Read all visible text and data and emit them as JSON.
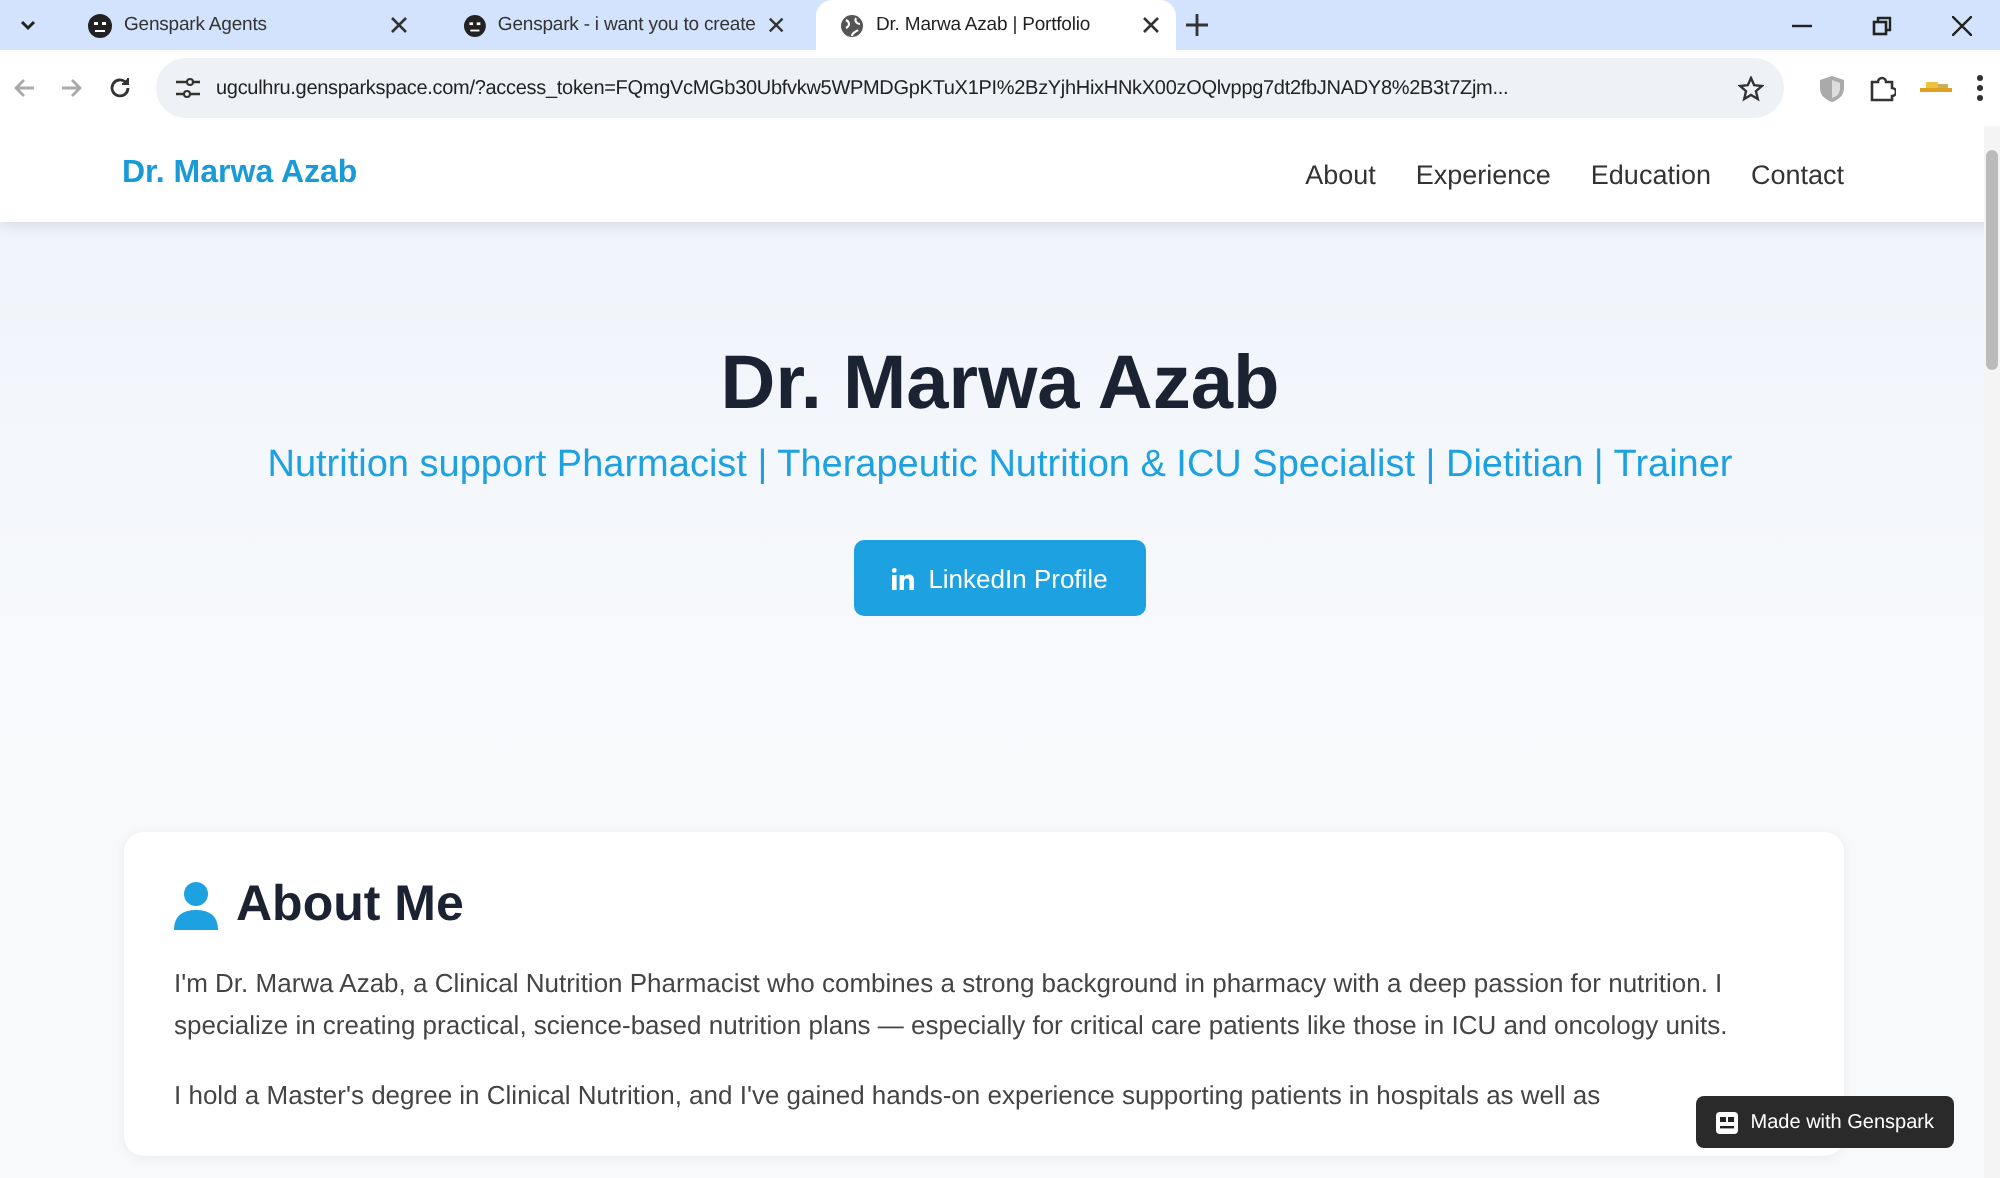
{
  "browser": {
    "tabs": [
      {
        "title": "Genspark Agents",
        "kind": "app",
        "selected": false
      },
      {
        "title": "Genspark - i want you to create",
        "kind": "app",
        "selected": false
      },
      {
        "title": "Dr. Marwa Azab | Portfolio",
        "kind": "site",
        "selected": true
      }
    ],
    "url": "ugculhru.gensparkspace.com/?access_token=FQmgVcMGb30Ubfvkw5WPMDGpKTuX1PI%2BzYjhHixHNkX00zOQlvppg7dt2fbJNADY8%2B3t7Zjm..."
  },
  "nav": {
    "brand": "Dr. Marwa Azab",
    "links": [
      "About",
      "Experience",
      "Education",
      "Contact"
    ]
  },
  "hero": {
    "name": "Dr. Marwa Azab",
    "tagline": "Nutrition support Pharmacist | Therapeutic Nutrition & ICU Specialist | Dietitian | Trainer",
    "button": "LinkedIn Profile"
  },
  "about": {
    "heading": "About Me",
    "paragraphs": [
      "I'm Dr. Marwa Azab, a Clinical Nutrition Pharmacist who combines a strong background in pharmacy with a deep passion for nutrition. I specialize in creating practical, science-based nutrition plans — especially for critical care patients like those in ICU and oncology units.",
      "I hold a Master's degree in Clinical Nutrition, and I've gained hands-on experience supporting patients in hospitals as well as"
    ]
  },
  "badge": "Made with Genspark"
}
